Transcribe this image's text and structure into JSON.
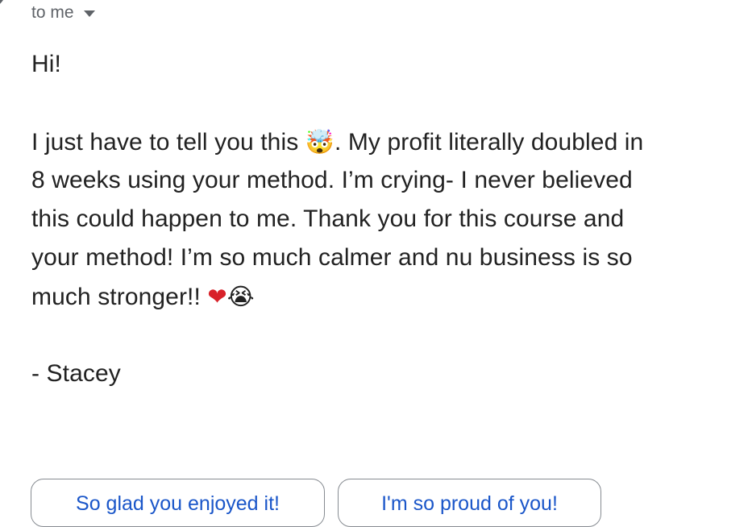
{
  "header": {
    "recipient_label": "to me"
  },
  "message": {
    "greeting": "Hi!",
    "line1_a": "I just have to tell you this ",
    "line1_emoji": "🤯",
    "line1_b": ". My profit literally doubled in",
    "line2": "8 weeks using your method. I’m crying- I never believed",
    "line3": "this could happen to me. Thank you for this course and",
    "line4": "your method! I’m so much calmer and nu business is so",
    "line5_text": "much stronger!! ",
    "line5_heart": "❤",
    "line5_cry": "😭",
    "signature": "- Stacey"
  },
  "smart_replies": [
    {
      "label": "So glad you enjoyed it!"
    },
    {
      "label": "I'm so proud of you!"
    }
  ],
  "colors": {
    "link": "#1a56c9",
    "text": "#222222",
    "muted": "#5f6368",
    "heart": "#d8222a"
  }
}
